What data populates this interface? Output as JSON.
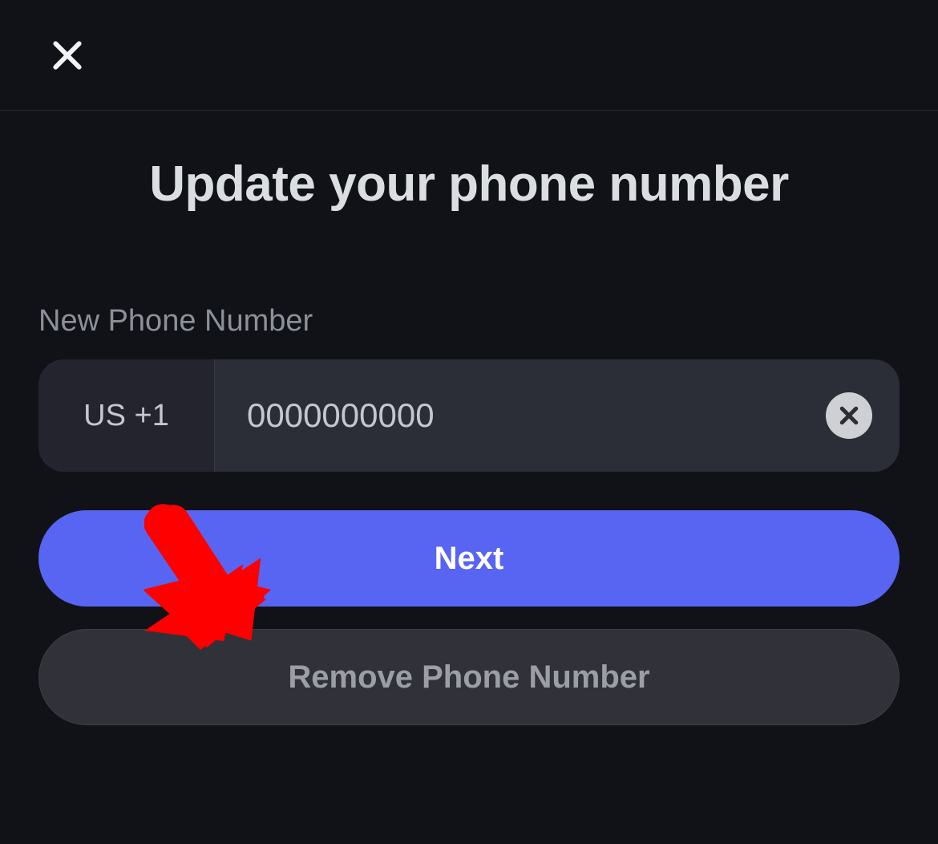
{
  "title": "Update your phone number",
  "form": {
    "label": "New Phone Number",
    "country_code": "US +1",
    "phone_placeholder": "0000000000",
    "phone_value": ""
  },
  "buttons": {
    "next": "Next",
    "remove": "Remove Phone Number"
  },
  "annotation": {
    "arrow_color": "#ff0000"
  }
}
